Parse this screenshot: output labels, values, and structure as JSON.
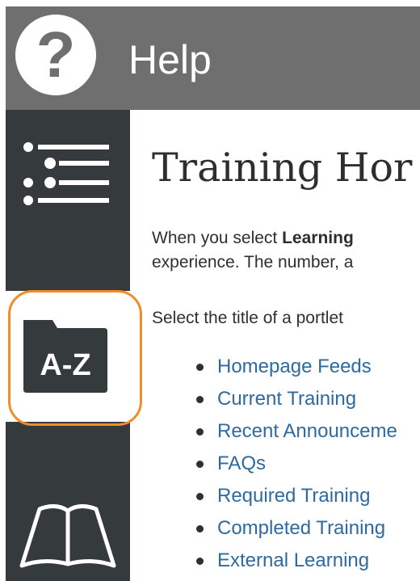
{
  "header": {
    "title": "Help",
    "icon": "question-circle-icon"
  },
  "sidebar": {
    "items": [
      {
        "name": "list-view",
        "icon": "bullet-list-icon"
      },
      {
        "name": "a-to-z",
        "icon": "a-z-folder-icon",
        "label": "A-Z"
      },
      {
        "name": "training-catalog",
        "icon": "open-book-icon"
      }
    ]
  },
  "main": {
    "title": "Training Hor",
    "para1_prefix": "When you select ",
    "para1_bold": "Learning",
    "para1_line2": "experience. The number, a",
    "para2": "Select the title of a portlet",
    "links": [
      "Homepage Feeds",
      "Current Training",
      "Recent Announceme",
      "FAQs",
      "Required Training",
      "Completed Training",
      "External Learning"
    ]
  },
  "colors": {
    "header_bg": "#6f6f6f",
    "sidebar_bg": "#353a3c",
    "link": "#2e6aa1",
    "highlight": "#f28c28"
  }
}
